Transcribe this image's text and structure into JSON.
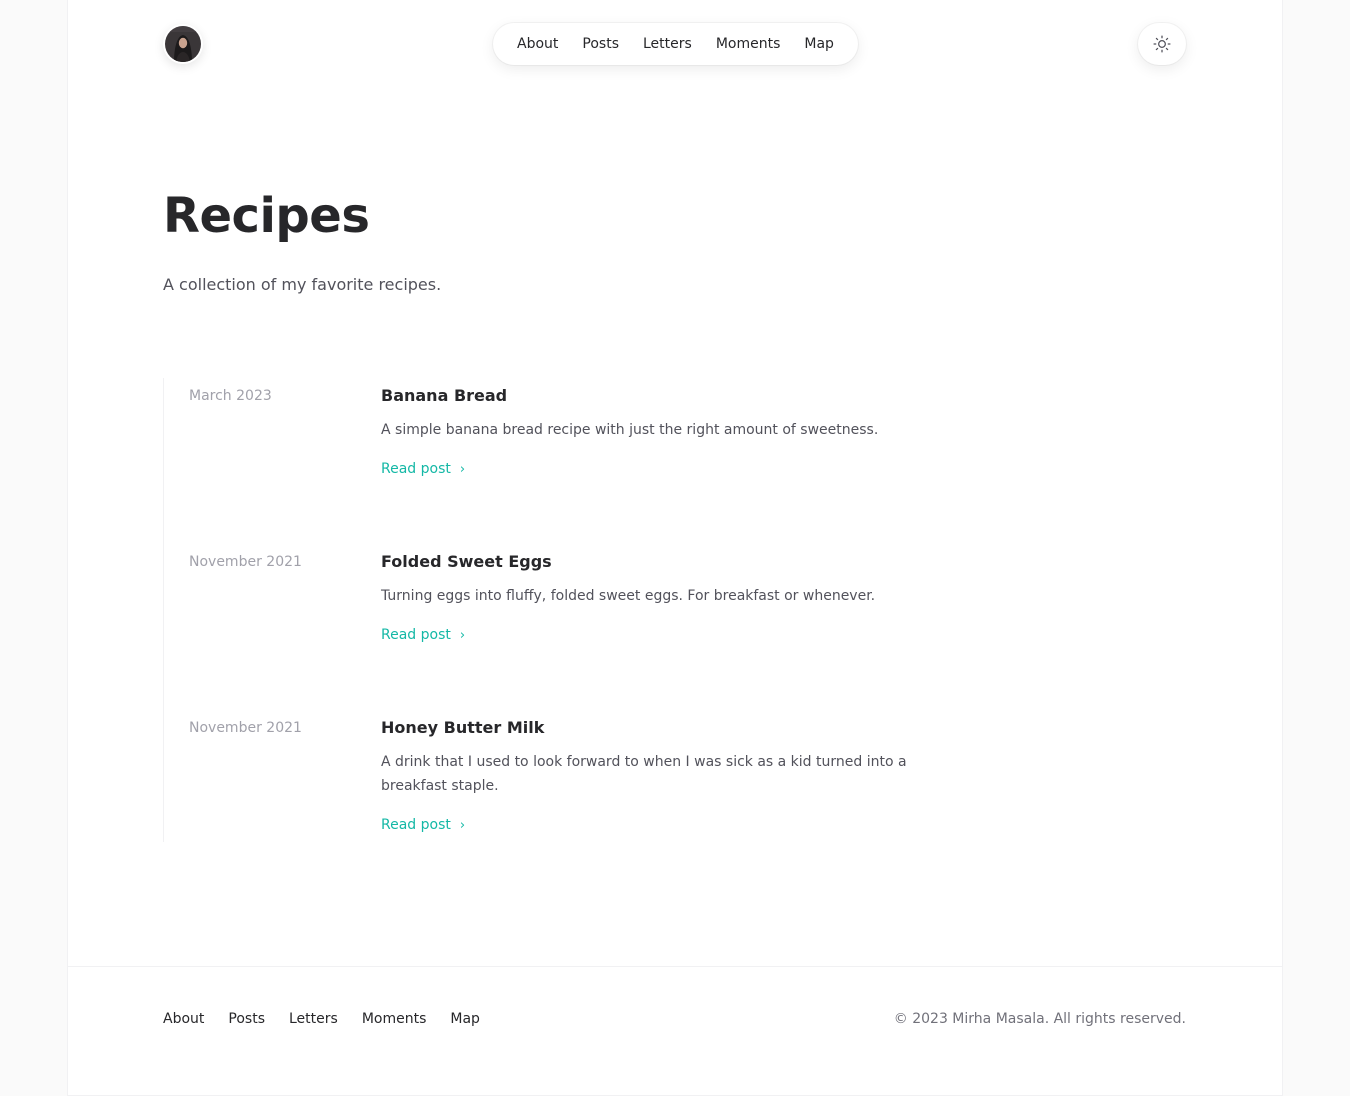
{
  "header": {
    "avatar_alt": "Profile photo",
    "nav": [
      {
        "label": "About"
      },
      {
        "label": "Posts"
      },
      {
        "label": "Letters"
      },
      {
        "label": "Moments"
      },
      {
        "label": "Map"
      }
    ],
    "theme_icon": "sun-icon"
  },
  "page": {
    "title": "Recipes",
    "subtitle": "A collection of my favorite recipes."
  },
  "articles": [
    {
      "date": "March 2023",
      "title": "Banana Bread",
      "description": "A simple banana bread recipe with just the right amount of sweetness.",
      "link": "Read post"
    },
    {
      "date": "November 2021",
      "title": "Folded Sweet Eggs",
      "description": "Turning eggs into fluffy, folded sweet eggs. For breakfast or whenever.",
      "link": "Read post"
    },
    {
      "date": "November 2021",
      "title": "Honey Butter Milk",
      "description": "A drink that I used to look forward to when I was sick as a kid turned into a breakfast staple.",
      "link": "Read post"
    }
  ],
  "footer": {
    "nav": [
      {
        "label": "About"
      },
      {
        "label": "Posts"
      },
      {
        "label": "Letters"
      },
      {
        "label": "Moments"
      },
      {
        "label": "Map"
      }
    ],
    "copyright": "© 2023 Mirha Masala. All rights reserved."
  },
  "colors": {
    "accent": "#14b8a6",
    "text": "#27272a",
    "muted": "#a1a1aa"
  }
}
